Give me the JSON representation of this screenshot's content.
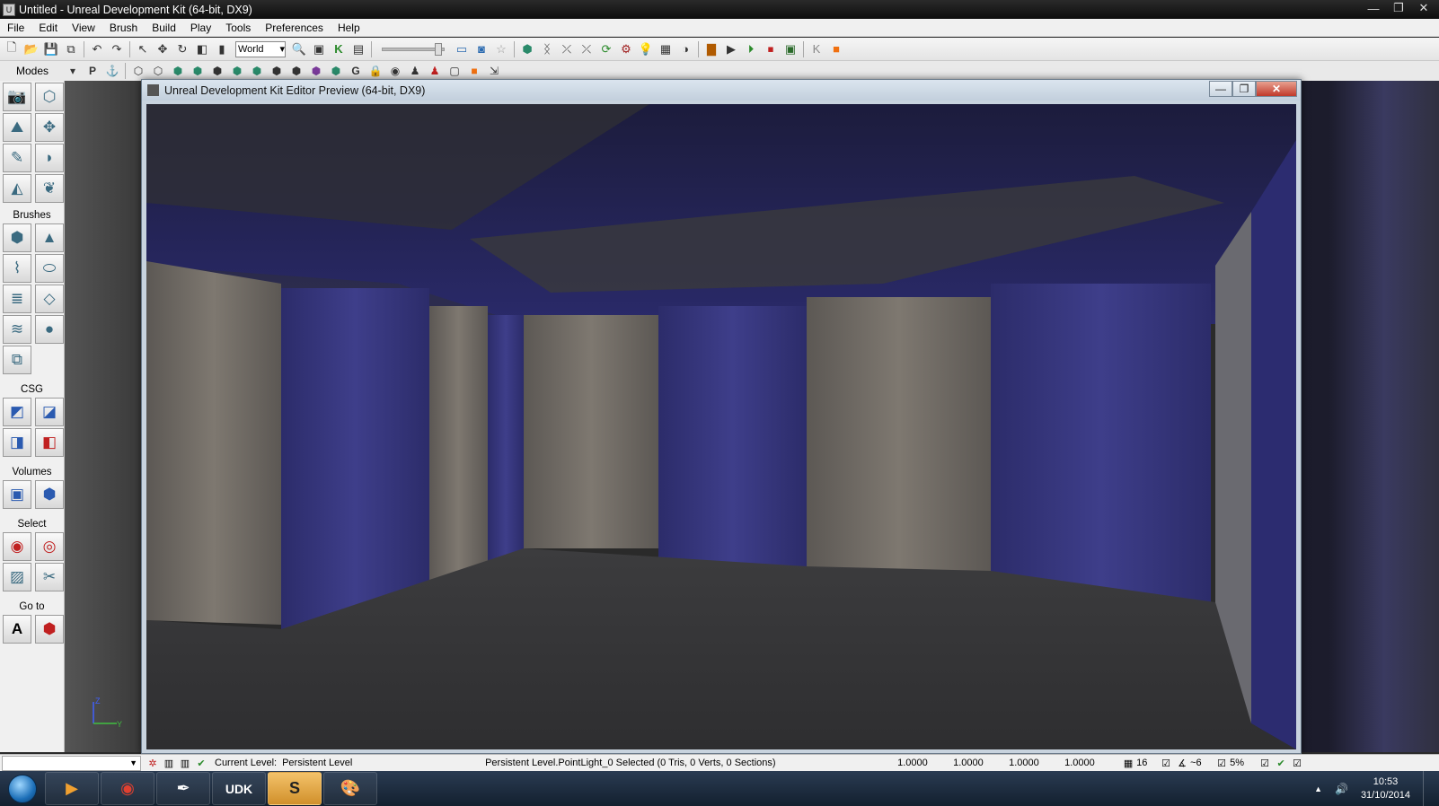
{
  "window": {
    "title": "Untitled - Unreal Development Kit (64-bit, DX9)",
    "controls": [
      "—",
      "❐",
      "✕"
    ]
  },
  "menu": [
    "File",
    "Edit",
    "View",
    "Brush",
    "Build",
    "Play",
    "Tools",
    "Preferences",
    "Help"
  ],
  "toolbar": {
    "coordinate_system": "World",
    "icons": [
      "new-icon",
      "open-icon",
      "save-icon",
      "save-all-icon",
      "undo-icon",
      "redo-icon",
      "select-icon",
      "translate-icon",
      "rotate-icon",
      "scale-icon",
      "search-icon",
      "texture-icon",
      "kismet-icon",
      "content-browser-icon",
      "view-mode-icon",
      "realtime-icon",
      "star-icon",
      "build-icon",
      "build-lighting-icon",
      "build-paths-icon",
      "build-all-icon",
      "play-icon",
      "console-icon"
    ]
  },
  "modes_panel": {
    "modes_label": "Modes",
    "p_label": "P",
    "sections": [
      {
        "label": "",
        "tools": [
          "camera-icon",
          "geometry-icon",
          "terrain-icon",
          "move-icon",
          "paint-icon",
          "texture-icon",
          "mesh-paint-icon",
          "foliage-icon"
        ]
      },
      {
        "label": "Brushes",
        "tools": [
          "cube-icon",
          "cone-icon",
          "stairs-icon",
          "cylinder-icon",
          "linear-stairs-icon",
          "sheet-icon",
          "spiral-stairs-icon",
          "sphere-icon",
          "volumetric-icon"
        ]
      },
      {
        "label": "CSG",
        "tools": [
          "csg-add-icon",
          "csg-subtract-icon",
          "csg-intersect-icon",
          "csg-deintersect-icon"
        ]
      },
      {
        "label": "Volumes",
        "tools": [
          "add-volume-icon",
          "volume-icon"
        ]
      },
      {
        "label": "Select",
        "tools": [
          "show-selected-icon",
          "hide-selected-icon",
          "select-all-icon",
          "invert-selection-icon"
        ]
      },
      {
        "label": "Go to",
        "tools": [
          "goto-actor-icon",
          "goto-builder-brush-icon"
        ]
      }
    ]
  },
  "preview_window": {
    "title": "Unreal Development Kit Editor Preview (64-bit, DX9)",
    "controls": [
      "—",
      "❐",
      "✕"
    ]
  },
  "statusbar": {
    "current_level_label": "Current Level:",
    "current_level_value": "Persistent Level",
    "selection_info": "Persistent Level.PointLight_0 Selected (0 Tris, 0 Verts, 0 Sections)",
    "drag_scale": [
      "1.0000",
      "1.0000",
      "1.0000",
      "1.0000"
    ],
    "grid_size": "16",
    "rotation_snap": "~6",
    "scale_snap": "5%"
  },
  "taskbar": {
    "apps": [
      {
        "name": "media-player-icon",
        "glyph": "▶"
      },
      {
        "name": "chrome-icon",
        "glyph": "◉"
      },
      {
        "name": "inkscape-icon",
        "glyph": "✒"
      },
      {
        "name": "udk-icon",
        "glyph": "UDK"
      },
      {
        "name": "sublime-icon",
        "glyph": "S"
      },
      {
        "name": "paint-icon",
        "glyph": "🎨"
      }
    ],
    "clock_time": "10:53",
    "clock_date": "31/10/2014"
  },
  "colors": {
    "wall_blue": "#3a3a80",
    "wall_grey": "#7a746c",
    "ceiling_blue": "#22225a",
    "floor_grey": "#3a3a3a"
  }
}
